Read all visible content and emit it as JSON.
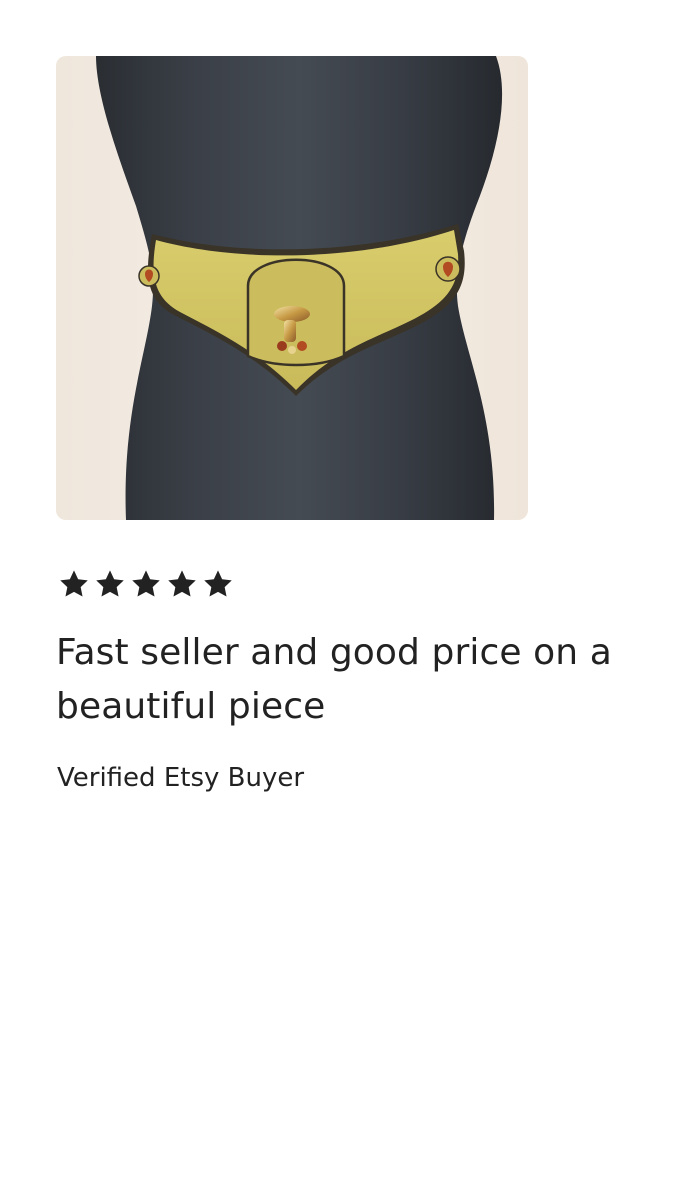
{
  "review": {
    "image_alt": "Yellow suede belt with gold buckle on a dark dress form",
    "rating": 5,
    "rating_max": 5,
    "star_color": "#222222",
    "title": "Fast seller and good price on a beautiful piece",
    "reviewer": "Verified Etsy Buyer"
  }
}
